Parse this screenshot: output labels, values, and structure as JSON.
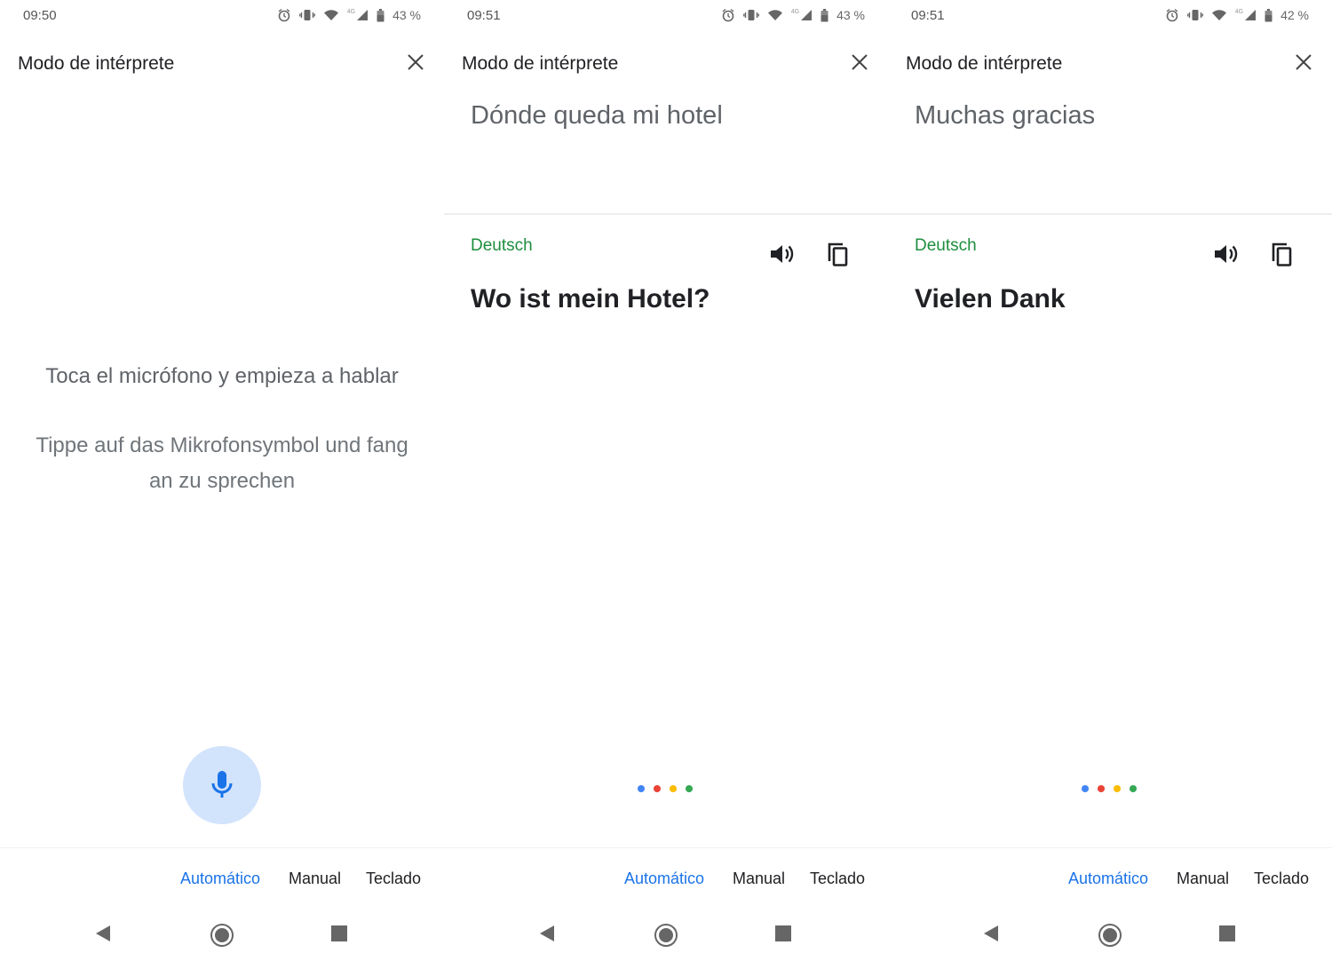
{
  "app": {
    "title": "Modo de intérprete"
  },
  "modes": {
    "automatic": "Automático",
    "manual": "Manual",
    "keyboard": "Teclado"
  },
  "colors": {
    "accent": "#1a73e8",
    "lang_green": "#1e8e3e",
    "dot_blue": "#4285f4",
    "dot_red": "#ea4335",
    "dot_yellow": "#fbbc04",
    "dot_green": "#34a853",
    "mic_bg": "#d2e3fc"
  },
  "screens": [
    {
      "status": {
        "time": "09:50",
        "battery": "43 %",
        "network": "4G"
      },
      "instruction_es": "Toca el micrófono y empieza a hablar",
      "instruction_de": "Tippe auf das Mikrofonsymbol und fang an zu sprechen"
    },
    {
      "status": {
        "time": "09:51",
        "battery": "43 %",
        "network": "4G"
      },
      "source_text": "Dónde queda mi hotel",
      "target_language": "Deutsch",
      "target_text": "Wo ist mein Hotel?"
    },
    {
      "status": {
        "time": "09:51",
        "battery": "42 %",
        "network": "4G"
      },
      "source_text": "Muchas gracias",
      "target_language": "Deutsch",
      "target_text": "Vielen Dank"
    }
  ]
}
